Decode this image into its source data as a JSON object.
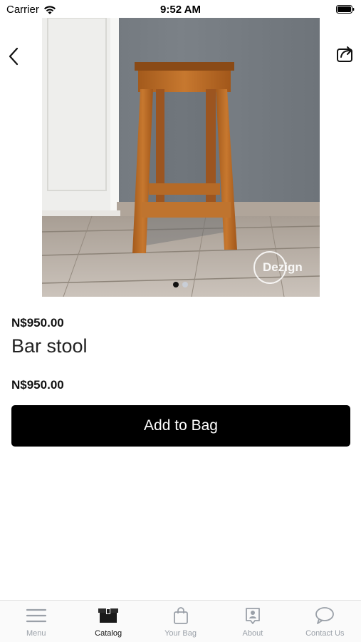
{
  "status_bar": {
    "carrier": "Carrier",
    "time": "9:52 AM"
  },
  "hero": {
    "watermark": "Dezign",
    "page_count": 2,
    "active_page": 1
  },
  "product": {
    "price_top": "N$950.00",
    "title": "Bar stool",
    "price_bottom": "N$950.00",
    "add_label": "Add to Bag"
  },
  "tabs": [
    {
      "label": "Menu",
      "icon": "menu-icon",
      "active": false
    },
    {
      "label": "Catalog",
      "icon": "catalog-icon",
      "active": true
    },
    {
      "label": "Your Bag",
      "icon": "bag-icon",
      "active": false
    },
    {
      "label": "About",
      "icon": "about-icon",
      "active": false
    },
    {
      "label": "Contact Us",
      "icon": "chat-icon",
      "active": false
    }
  ],
  "colors": {
    "accent": "#000000",
    "tab_inactive": "#9aa0a8",
    "tab_active": "#111111"
  }
}
